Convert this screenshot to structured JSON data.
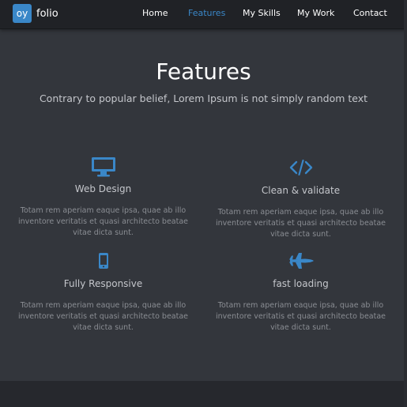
{
  "brand": {
    "badge": "oy",
    "name": "folio"
  },
  "nav": {
    "items": [
      "Home",
      "Features",
      "My Skills",
      "My Work",
      "Contact"
    ],
    "active": "Features"
  },
  "section": {
    "title": "Features",
    "subtitle": "Contrary to popular belief, Lorem Ipsum is not simply random text"
  },
  "features": [
    {
      "icon": "monitor-icon",
      "title": "Web Design",
      "desc": "Totam rem aperiam eaque ipsa, quae ab illo inventore veritatis et quasi architecto beatae vitae dicta sunt."
    },
    {
      "icon": "code-icon",
      "title": "Clean & validate",
      "desc": "Totam rem aperiam eaque ipsa, quae ab illo inventore veritatis et quasi architecto beatae vitae dicta sunt."
    },
    {
      "icon": "mobile-icon",
      "title": "Fully Responsive",
      "desc": "Totam rem aperiam eaque ipsa, quae ab illo inventore veritatis et quasi architecto beatae vitae dicta sunt."
    },
    {
      "icon": "plane-icon",
      "title": "fast loading",
      "desc": "Totam rem aperiam eaque ipsa, quae ab illo inventore veritatis et quasi architecto beatae vitae dicta sunt."
    }
  ],
  "colors": {
    "accent": "#3a87c8",
    "background": "#33363c",
    "navbar": "#202226",
    "footer": "#26282d"
  }
}
